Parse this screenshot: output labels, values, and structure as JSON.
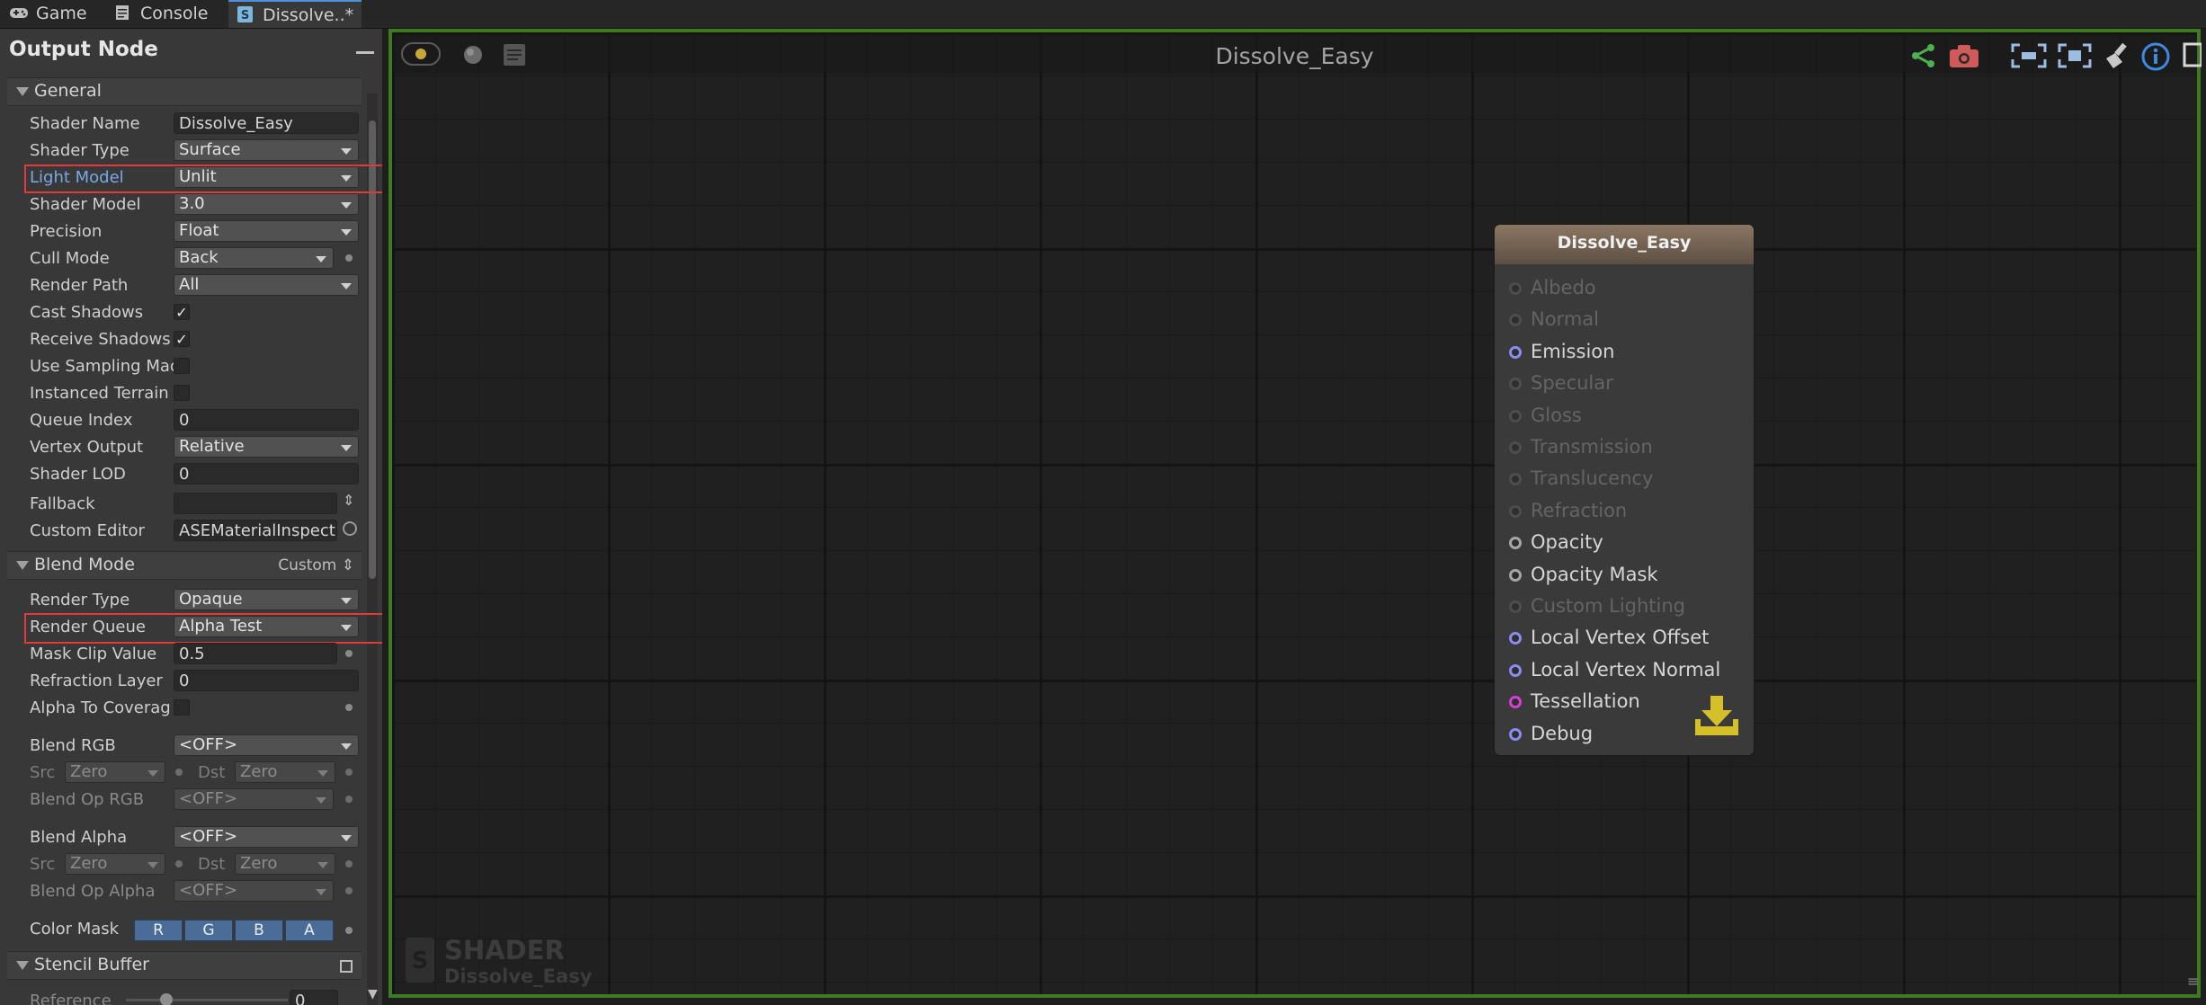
{
  "tabs": [
    {
      "label": "Game",
      "icon": "gamepad-icon"
    },
    {
      "label": "Console",
      "icon": "console-icon"
    },
    {
      "label": "Dissolve..*",
      "icon": "shader-file-icon"
    }
  ],
  "panel": {
    "title": "Output Node",
    "sections": {
      "general": "General",
      "blend_mode": "Blend Mode",
      "blend_mode_value": "Custom",
      "stencil_buffer": "Stencil Buffer"
    },
    "general": {
      "shader_name_label": "Shader Name",
      "shader_name": "Dissolve_Easy",
      "shader_type_label": "Shader Type",
      "shader_type": "Surface",
      "light_model_label": "Light Model",
      "light_model": "Unlit",
      "shader_model_label": "Shader Model",
      "shader_model": "3.0",
      "precision_label": "Precision",
      "precision": "Float",
      "cull_mode_label": "Cull Mode",
      "cull_mode": "Back",
      "render_path_label": "Render Path",
      "render_path": "All",
      "cast_shadows_label": "Cast Shadows",
      "cast_shadows": "✓",
      "receive_shadows_label": "Receive Shadows",
      "receive_shadows": "✓",
      "use_sampling_label": "Use Sampling Mac",
      "instanced_terrain_label": "Instanced Terrain",
      "queue_index_label": "Queue Index",
      "queue_index": "0",
      "vertex_output_label": "Vertex Output",
      "vertex_output": "Relative",
      "shader_lod_label": "Shader LOD",
      "shader_lod": "0",
      "fallback_label": "Fallback",
      "fallback": "",
      "custom_editor_label": "Custom Editor",
      "custom_editor": "ASEMaterialInspect"
    },
    "blend": {
      "render_type_label": "Render Type",
      "render_type": "Opaque",
      "render_queue_label": "Render Queue",
      "render_queue": "Alpha Test",
      "mask_clip_label": "Mask Clip Value",
      "mask_clip": "0.5",
      "refraction_layer_label": "Refraction Layer",
      "refraction_layer": "0",
      "alpha_to_coverage_label": "Alpha To Coverag",
      "blend_rgb_label": "Blend RGB",
      "blend_rgb": "<OFF>",
      "src_label": "Src",
      "dst_label": "Dst",
      "rgb_src": "Zero",
      "rgb_dst": "Zero",
      "blend_op_rgb_label": "Blend Op RGB",
      "blend_op_rgb": "<OFF>",
      "blend_alpha_label": "Blend Alpha",
      "blend_alpha": "<OFF>",
      "alpha_src": "Zero",
      "alpha_dst": "Zero",
      "blend_op_alpha_label": "Blend Op Alpha",
      "blend_op_alpha": "<OFF>",
      "color_mask_label": "Color Mask",
      "color_mask": [
        "R",
        "G",
        "B",
        "A"
      ]
    },
    "stencil": {
      "reference_label": "Reference",
      "reference": "0"
    }
  },
  "canvas": {
    "title": "Dissolve_Easy",
    "node": {
      "title": "Dissolve_Easy",
      "ports": [
        {
          "label": "Albedo",
          "active": false,
          "color": "#4d4d4d"
        },
        {
          "label": "Normal",
          "active": false,
          "color": "#4d4d4d"
        },
        {
          "label": "Emission",
          "active": true,
          "color": "#8a8cf0"
        },
        {
          "label": "Specular",
          "active": false,
          "color": "#4d4d4d"
        },
        {
          "label": "Gloss",
          "active": false,
          "color": "#4d4d4d"
        },
        {
          "label": "Transmission",
          "active": false,
          "color": "#4d4d4d"
        },
        {
          "label": "Translucency",
          "active": false,
          "color": "#4d4d4d"
        },
        {
          "label": "Refraction",
          "active": false,
          "color": "#4d4d4d"
        },
        {
          "label": "Opacity",
          "active": true,
          "color": "#a6a6a6"
        },
        {
          "label": "Opacity Mask",
          "active": true,
          "color": "#a6a6a6"
        },
        {
          "label": "Custom Lighting",
          "active": false,
          "color": "#4d4d4d"
        },
        {
          "label": "Local Vertex Offset",
          "active": true,
          "color": "#8a8cf0"
        },
        {
          "label": "Local Vertex Normal",
          "active": true,
          "color": "#8a8cf0"
        },
        {
          "label": "Tessellation",
          "active": true,
          "color": "#d53fd5"
        },
        {
          "label": "Debug",
          "active": true,
          "color": "#8a8cf0"
        }
      ]
    },
    "watermark": {
      "title": "SHADER",
      "subtitle": "Dissolve_Easy"
    },
    "toolbar_icons": [
      "live-mode-icon",
      "preview-sphere-icon",
      "cheatsheet-icon",
      "share-icon",
      "camera-icon",
      "focus-selected-icon",
      "fit-view-icon",
      "clean-icon",
      "info-icon",
      "maximize-icon"
    ],
    "colors": {
      "accent_border": "#3d7a22",
      "highlight_box": "#e03a3a",
      "node_header": "#8b7762"
    }
  }
}
